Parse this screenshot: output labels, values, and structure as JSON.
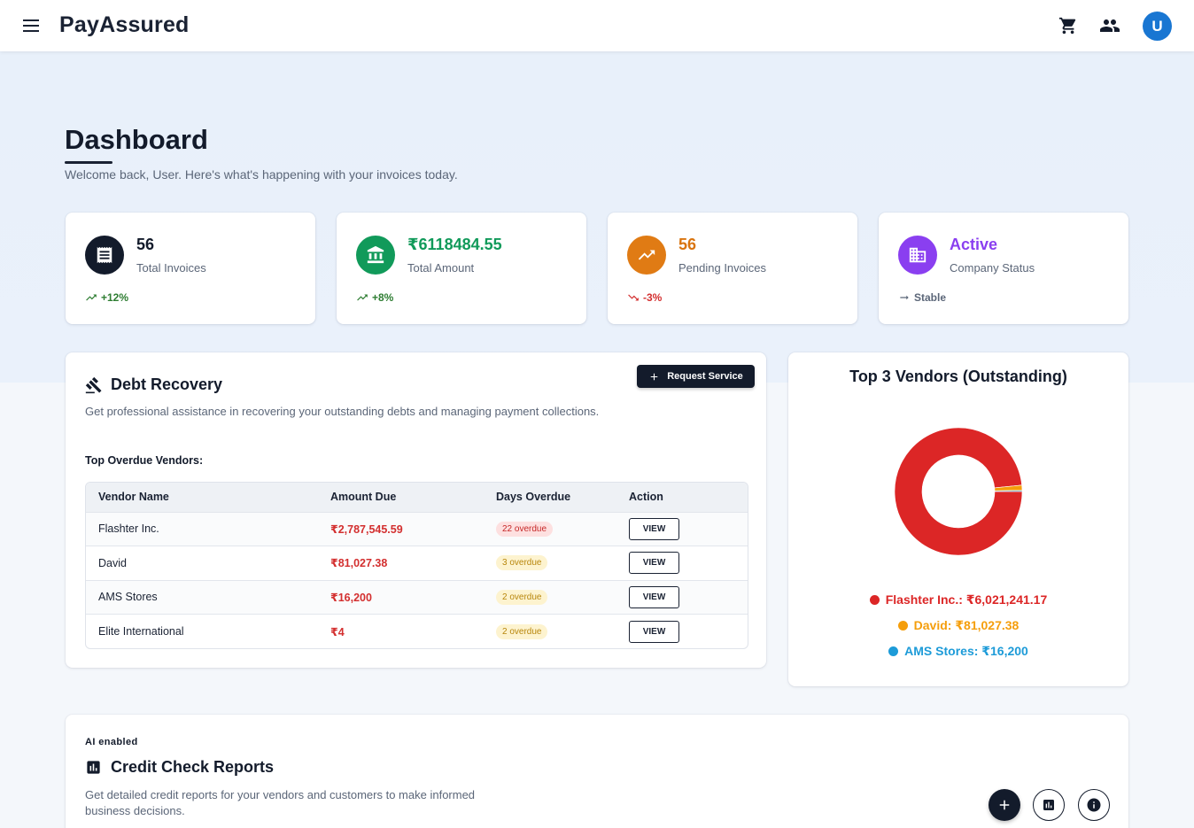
{
  "app": {
    "brand": "PayAssured",
    "avatar_initial": "U"
  },
  "header": {
    "icons": [
      "menu-icon",
      "cart-icon",
      "people-icon"
    ]
  },
  "page": {
    "title": "Dashboard",
    "subtitle": "Welcome back, User. Here's what's happening with your invoices today."
  },
  "stats": [
    {
      "value": "56",
      "label": "Total Invoices",
      "trend": "+12%",
      "trend_dir": "up",
      "icon": "receipt-icon",
      "icon_bg": "#131b2b",
      "value_color": "#131b2b",
      "trend_color": "#2e7d32"
    },
    {
      "value": "₹6118484.55",
      "label": "Total Amount",
      "trend": "+8%",
      "trend_dir": "up",
      "icon": "bank-icon",
      "icon_bg": "#119a5a",
      "value_color": "#119a5a",
      "trend_color": "#2e7d32"
    },
    {
      "value": "56",
      "label": "Pending Invoices",
      "trend": "-3%",
      "trend_dir": "down",
      "icon": "trending-up-icon",
      "icon_bg": "#e07b14",
      "value_color": "#d9740f",
      "trend_color": "#d32f2f"
    },
    {
      "value": "Active",
      "label": "Company Status",
      "trend": "Stable",
      "trend_dir": "flat",
      "icon": "building-icon",
      "icon_bg": "#8a3ff0",
      "value_color": "#8a3ff0",
      "trend_color": "#5b6678"
    }
  ],
  "debt": {
    "title": "Debt Recovery",
    "button": "Request Service",
    "description": "Get professional assistance in recovering your outstanding debts and managing payment collections.",
    "table_title": "Top Overdue Vendors:",
    "columns": [
      "Vendor Name",
      "Amount Due",
      "Days Overdue",
      "Action"
    ],
    "rows": [
      {
        "vendor": "Flashter Inc.",
        "amount": "₹2,787,545.59",
        "days": "22 overdue",
        "level": "red",
        "action": "VIEW"
      },
      {
        "vendor": "David",
        "amount": "₹81,027.38",
        "days": "3 overdue",
        "level": "amber",
        "action": "VIEW"
      },
      {
        "vendor": "AMS Stores",
        "amount": "₹16,200",
        "days": "2 overdue",
        "level": "amber",
        "action": "VIEW"
      },
      {
        "vendor": "Elite International",
        "amount": "₹4",
        "days": "2 overdue",
        "level": "amber",
        "action": "VIEW"
      }
    ]
  },
  "vendors_chart": {
    "title": "Top 3 Vendors (Outstanding)",
    "legend": [
      {
        "label": "Flashter Inc.: ₹6,021,241.17",
        "color": "#dc2626"
      },
      {
        "label": "David: ₹81,027.38",
        "color": "#f59e0b"
      },
      {
        "label": "AMS Stores: ₹16,200",
        "color": "#1d9bd8"
      }
    ]
  },
  "chart_data": {
    "type": "pie",
    "title": "Top 3 Vendors (Outstanding)",
    "categories": [
      "Flashter Inc.",
      "David",
      "AMS Stores"
    ],
    "values": [
      6021241.17,
      81027.38,
      16200
    ],
    "colors": [
      "#dc2626",
      "#f59e0b",
      "#1d9bd8"
    ],
    "legend": "bottom"
  },
  "credit": {
    "tag": "AI enabled",
    "title": "Credit Check Reports",
    "description": "Get detailed credit reports for your vendors and customers to make informed business decisions."
  }
}
